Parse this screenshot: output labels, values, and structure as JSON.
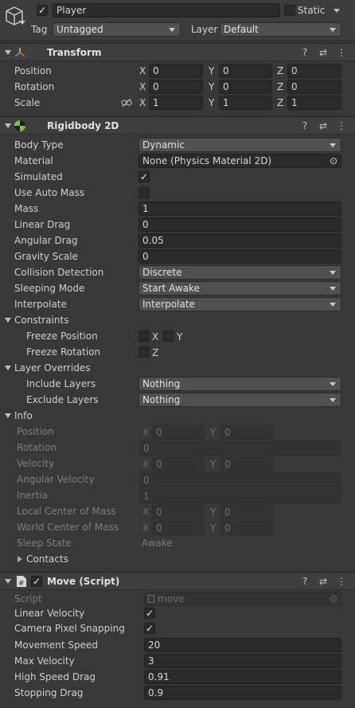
{
  "object": {
    "name": "Player",
    "static_label": "Static",
    "tag_label": "Tag",
    "tag_value": "Untagged",
    "layer_label": "Layer",
    "layer_value": "Default"
  },
  "transform": {
    "title": "Transform",
    "position_label": "Position",
    "rotation_label": "Rotation",
    "scale_label": "Scale",
    "position": {
      "x": "0",
      "y": "0",
      "z": "0"
    },
    "rotation": {
      "x": "0",
      "y": "0",
      "z": "0"
    },
    "scale": {
      "x": "1",
      "y": "1",
      "z": "1"
    }
  },
  "axes": {
    "x": "X",
    "y": "Y",
    "z": "Z"
  },
  "rigidbody": {
    "title": "Rigidbody 2D",
    "body_type_label": "Body Type",
    "body_type": "Dynamic",
    "material_label": "Material",
    "material": "None (Physics Material 2D)",
    "simulated_label": "Simulated",
    "use_auto_mass_label": "Use Auto Mass",
    "mass_label": "Mass",
    "mass": "1",
    "linear_drag_label": "Linear Drag",
    "linear_drag": "0",
    "angular_drag_label": "Angular Drag",
    "angular_drag": "0.05",
    "gravity_scale_label": "Gravity Scale",
    "gravity_scale": "0",
    "collision_detection_label": "Collision Detection",
    "collision_detection": "Discrete",
    "sleeping_mode_label": "Sleeping Mode",
    "sleeping_mode": "Start Awake",
    "interpolate_label": "Interpolate",
    "interpolate": "Interpolate",
    "constraints_label": "Constraints",
    "freeze_position_label": "Freeze Position",
    "freeze_rotation_label": "Freeze Rotation",
    "layer_overrides_label": "Layer Overrides",
    "include_layers_label": "Include Layers",
    "include_layers": "Nothing",
    "exclude_layers_label": "Exclude Layers",
    "exclude_layers": "Nothing",
    "info_label": "Info",
    "info": {
      "position_label": "Position",
      "position": {
        "x": "0",
        "y": "0"
      },
      "rotation_label": "Rotation",
      "rotation": "0",
      "velocity_label": "Velocity",
      "velocity": {
        "x": "0",
        "y": "0"
      },
      "angular_velocity_label": "Angular Velocity",
      "angular_velocity": "0",
      "inertia_label": "Inertia",
      "inertia": "1",
      "local_com_label": "Local Center of Mass",
      "local_com": {
        "x": "0",
        "y": "0"
      },
      "world_com_label": "World Center of Mass",
      "world_com": {
        "x": "0",
        "y": "0"
      },
      "sleep_state_label": "Sleep State",
      "sleep_state": "Awake",
      "contacts_label": "Contacts"
    }
  },
  "move_script": {
    "title": "Move (Script)",
    "script_label": "Script",
    "script_value": "move",
    "linear_velocity_label": "Linear Velocity",
    "camera_pixel_snapping_label": "Camera Pixel Snapping",
    "movement_speed_label": "Movement Speed",
    "movement_speed": "20",
    "max_velocity_label": "Max Velocity",
    "max_velocity": "3",
    "high_speed_drag_label": "High Speed Drag",
    "high_speed_drag": "0.91",
    "stopping_drag_label": "Stopping Drag",
    "stopping_drag": "0.9"
  },
  "glyphs": {
    "check": "✓",
    "help": "?",
    "presets": "⇄",
    "menu": "⋮",
    "object_picker": "⊙"
  },
  "colors": {
    "background": "#383838",
    "field": "#2a2a2a",
    "dropdown": "#505050",
    "header": "#3e3e3e"
  }
}
